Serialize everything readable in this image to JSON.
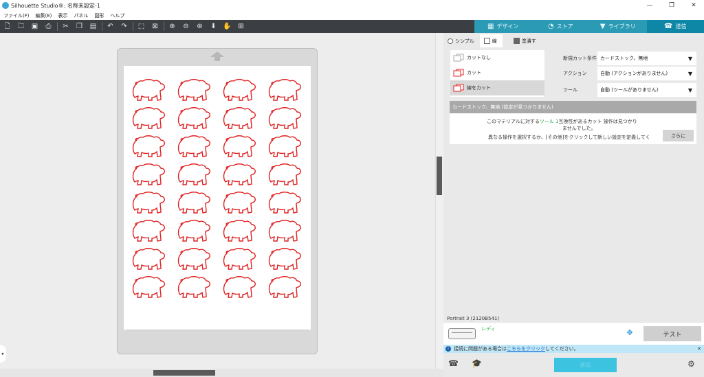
{
  "window": {
    "title": "Silhouette Studio®: 名称未設定-1",
    "controls": [
      "—",
      "❐",
      "✕"
    ]
  },
  "menu": [
    "ファイル(F)",
    "編集(E)",
    "表示",
    "パネル",
    "図形",
    "ヘルプ"
  ],
  "toolbar": {
    "icons": [
      "new-document-icon",
      "open-folder-icon",
      "save-icon",
      "print-icon",
      "cut-icon",
      "copy-icon",
      "paste-icon",
      "undo-icon",
      "redo-icon",
      "select-all-icon",
      "deselect-icon",
      "zoom-in-icon",
      "zoom-out-icon",
      "zoom-fit-icon",
      "move-down-icon",
      "pan-hand-icon",
      "fit-to-page-icon"
    ]
  },
  "nav_tabs": [
    {
      "label": "デザイン",
      "icon": "grid-icon"
    },
    {
      "label": "ストア",
      "icon": "store-icon"
    },
    {
      "label": "ライブラリ",
      "icon": "library-icon"
    },
    {
      "label": "送信",
      "icon": "send-icon",
      "active": true
    }
  ],
  "panel": {
    "tabs": [
      {
        "label": "シンプル"
      },
      {
        "label": "線",
        "active": true
      },
      {
        "label": "塗潰す"
      }
    ],
    "cut_options": [
      {
        "label": "カットなし"
      },
      {
        "label": "カット"
      },
      {
        "label": "線をカット",
        "selected": true
      }
    ],
    "settings": [
      {
        "label": "新規カット条件",
        "value": "カードストック、無地"
      },
      {
        "label": "アクション",
        "value": "自動 (アクションがありません)"
      },
      {
        "label": "ツール",
        "value": "自動 (ツールがありません)"
      }
    ],
    "material_header": "カードストック、無地 (設定が見つかりません)",
    "message_line1_a": "このマテリアルに対する",
    "message_line1_tool": "ツール 1",
    "message_line1_b": "互換性があるカット 操作は見つかり",
    "message_line1_c": "ませんでした。",
    "message_line2": "異なる操作を選択するか、[その他]をクリックして新しい設定を定義してくださ",
    "more_button": "さらに",
    "device_name": "Portrait 3 (2120B541)",
    "device_status": "レディ",
    "test_button": "テスト",
    "info_text_a": "接続に問題がある場合は",
    "info_link": "こちらをクリック",
    "info_text_b": "してください。",
    "info_close": "✕",
    "send_button": "送信"
  },
  "colors": {
    "cut_line": "#e02020",
    "accent": "#2a9ab5",
    "send": "#3cc3e0"
  },
  "design": {
    "shape": "bear",
    "rows": 8,
    "cols": 4
  }
}
